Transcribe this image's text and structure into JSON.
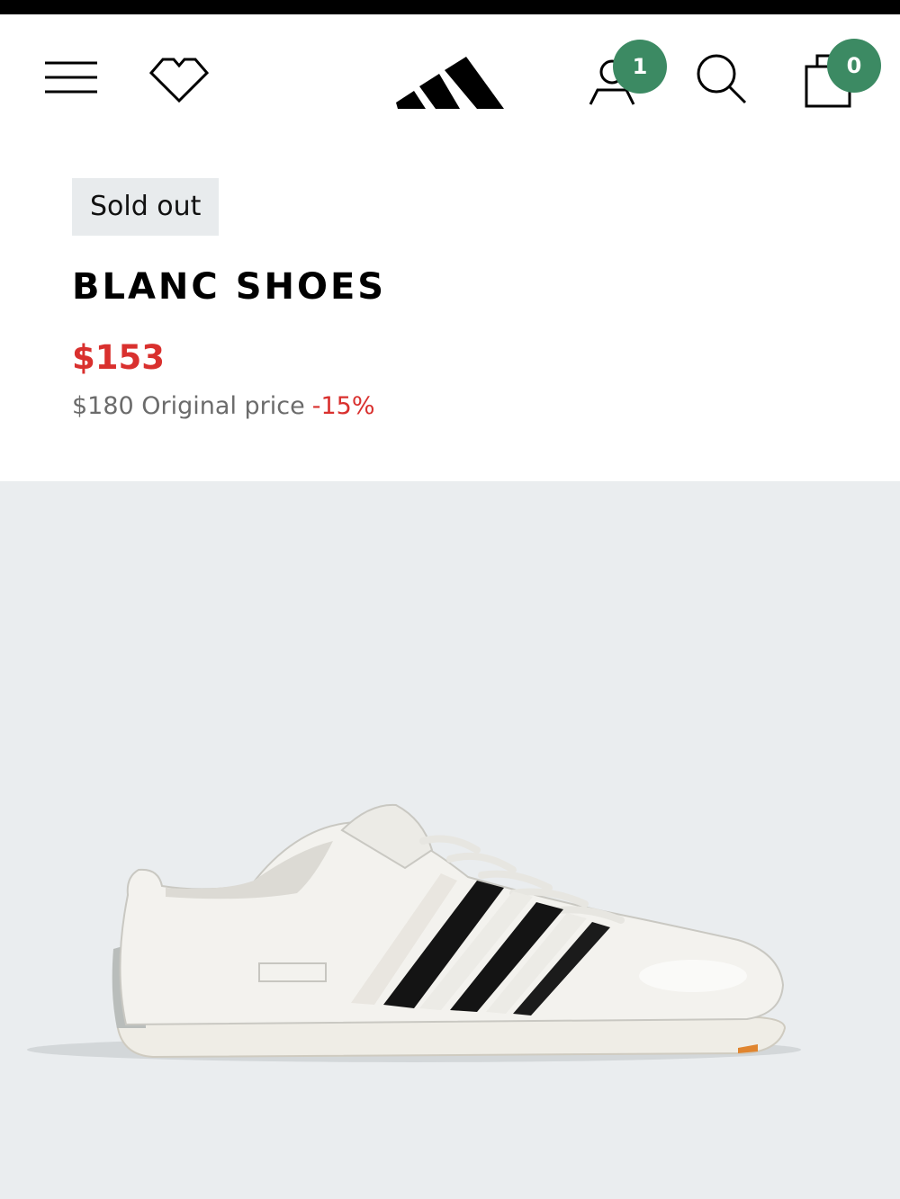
{
  "header": {
    "icons": {
      "menu": "menu-icon",
      "wishlist": "heart-icon",
      "logo": "adidas-logo",
      "account": "user-icon",
      "search": "search-icon",
      "bag": "shopping-bag-icon"
    },
    "account_badge": "1",
    "bag_badge": "0"
  },
  "product": {
    "status": "Sold out",
    "name": "BLANC SHOES",
    "sale_price": "$153",
    "original_price": "$180 Original price",
    "discount": "-15%"
  },
  "colors": {
    "badge_green": "#3c8a63",
    "sale_red": "#d9302e",
    "status_badge_bg": "#e8ebed",
    "image_bg": "#eaedef"
  }
}
